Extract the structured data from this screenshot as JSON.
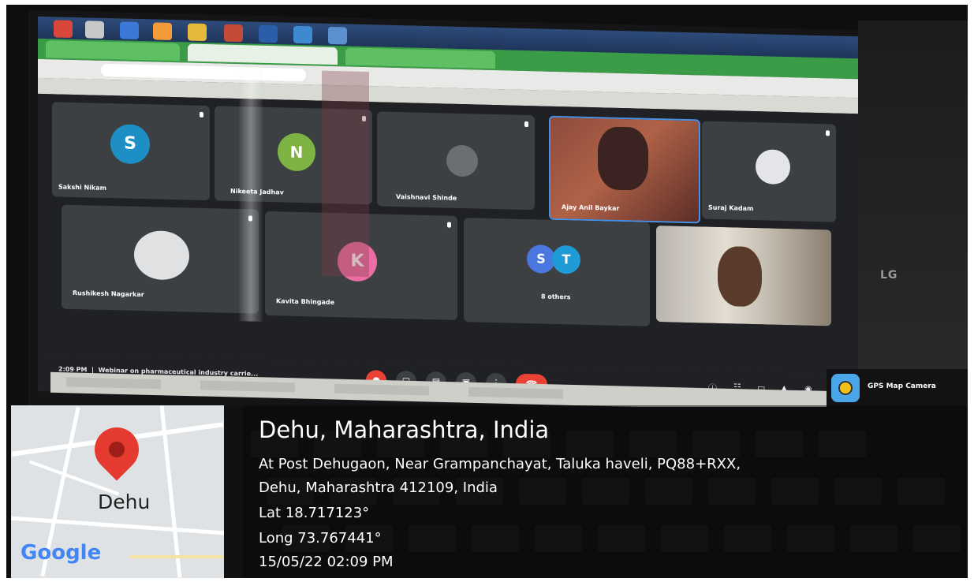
{
  "meet": {
    "participants": [
      {
        "name": "Sakshi Nikam",
        "initial": "S",
        "color": "#1e8fc4"
      },
      {
        "name": "Nikeeta Jadhav",
        "initial": "N",
        "color": "#7cb342"
      },
      {
        "name": "Vaishnavi Shinde",
        "initial": "",
        "color": ""
      },
      {
        "name": "Ajay Anil Baykar",
        "initial": "",
        "color": ""
      },
      {
        "name": "Suraj Kadam",
        "initial": "",
        "color": ""
      },
      {
        "name": "Rushikesh Nagarkar",
        "initial": "",
        "color": ""
      },
      {
        "name": "Kavita Bhingade",
        "initial": "K",
        "color": "#ea6ea4"
      },
      {
        "name": "8 others",
        "initial": "S",
        "initial2": "T",
        "color": "#4a78e0",
        "color2": "#1e9bd7"
      }
    ],
    "time": "2:09 PM",
    "meeting_title": "Webinar on pharmaceutical industry carrie..."
  },
  "monitor_brand": "LG",
  "gps": {
    "app_name": "GPS Map Camera",
    "place": "Dehu, Maharashtra, India",
    "address_line1": "At Post Dehugaon, Near Grampanchayat, Taluka haveli, PQ88+RXX,",
    "address_line2": "Dehu, Maharashtra 412109, India",
    "lat": "Lat 18.717123°",
    "long": "Long 73.767441°",
    "datetime": "15/05/22 02:09 PM",
    "map_label": "Dehu",
    "map_brand": "Google"
  },
  "colors": {
    "pin": "#e53a2f",
    "google_blue": "#4285f4"
  }
}
